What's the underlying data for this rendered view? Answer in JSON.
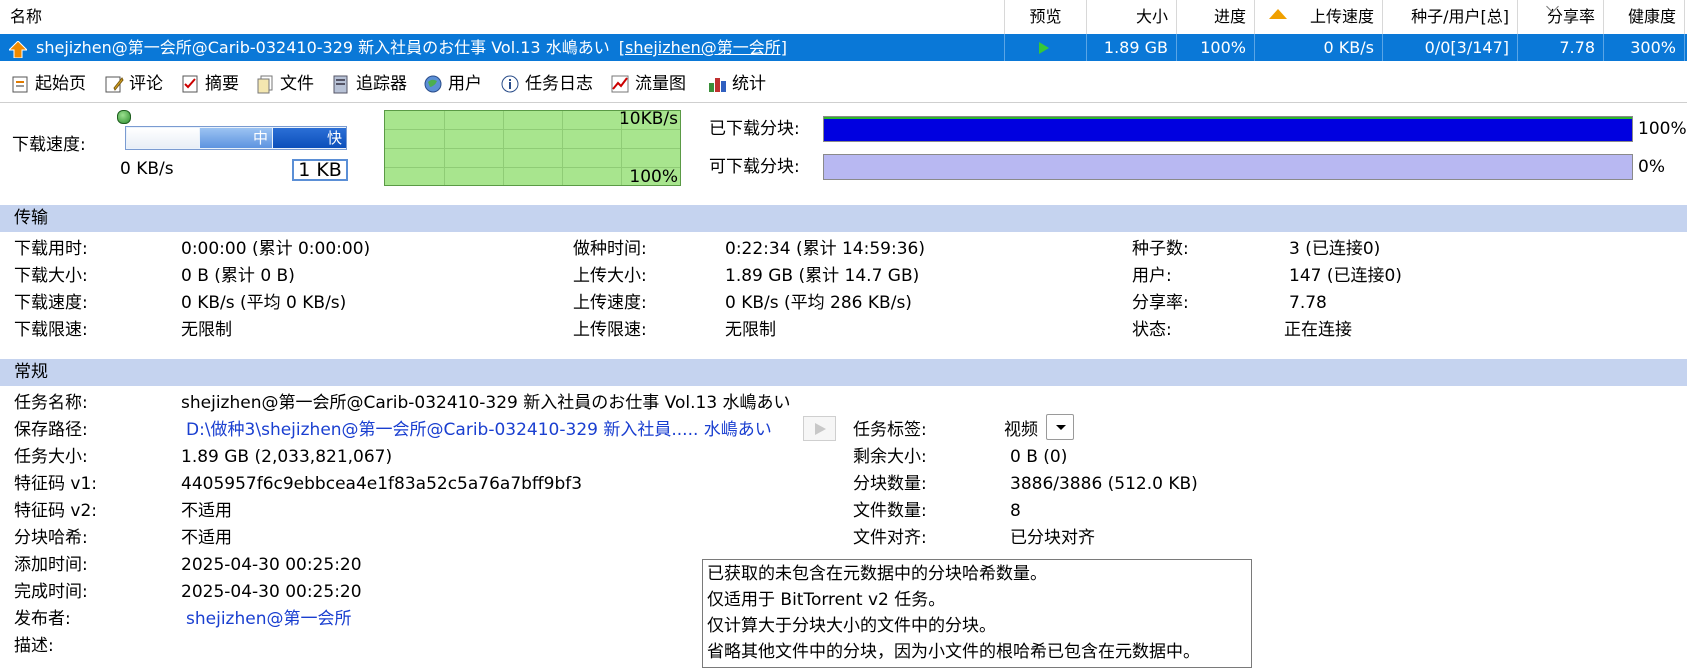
{
  "list": {
    "columns": {
      "name": "名称",
      "preview": "预览",
      "size": "大小",
      "progress": "进度",
      "upspeed": "上传速度",
      "seeds_peers": "种子/用户[总]",
      "ratio": "分享率",
      "health": "健康度"
    },
    "task": {
      "name": "shejizhen@第一会所@Carib-032410-329 新入社員のお仕事 Vol.13 水嶋あい",
      "tag": "[shejizhen@第一会所]",
      "size": "1.89 GB",
      "progress": "100%",
      "upspeed": "0 KB/s",
      "seeds_peers": "0/0[3/147]",
      "ratio": "7.78",
      "health": "300%"
    }
  },
  "tabs": [
    {
      "label": "起始页",
      "icon": "home-icon"
    },
    {
      "label": "评论",
      "icon": "comment-icon"
    },
    {
      "label": "摘要",
      "icon": "summary-icon"
    },
    {
      "label": "文件",
      "icon": "files-icon"
    },
    {
      "label": "追踪器",
      "icon": "tracker-icon"
    },
    {
      "label": "用户",
      "icon": "users-icon"
    },
    {
      "label": "任务日志",
      "icon": "info-icon"
    },
    {
      "label": "流量图",
      "icon": "chart-icon"
    },
    {
      "label": "统计",
      "icon": "stats-icon"
    }
  ],
  "summary": {
    "download_speed_label": "下载速度:",
    "current_speed": "0 KB/s",
    "slider_mid": "中",
    "slider_fast": "快",
    "limit_value": "1 KB",
    "graph_max": "10KB/s",
    "graph_pct": "100%",
    "downloaded_label": "已下载分块:",
    "downloaded_pct": "100%",
    "downloaded_fraction": 1.0,
    "available_label": "可下载分块:",
    "available_pct": "0%",
    "available_fraction": 1.0
  },
  "colors": {
    "selected_row": "#0a78d7",
    "section_bg": "#c5d3ef",
    "downloaded_bar": "#0000e0",
    "available_bar": "#b8b8f2",
    "graph_bg": "#a8e58e",
    "link": "#1a3fd0"
  },
  "transfer": {
    "title": "传输",
    "dl_time_label": "下载用时:",
    "dl_time": "0:00:00 (累计 0:00:00)",
    "dl_size_label": "下载大小:",
    "dl_size": "0 B (累计 0 B)",
    "dl_speed_label": "下载速度:",
    "dl_speed": "0 KB/s (平均 0 KB/s)",
    "dl_limit_label": "下载限速:",
    "dl_limit": "无限制",
    "seed_time_label": "做种时间:",
    "seed_time": "0:22:34 (累计 14:59:36)",
    "up_size_label": "上传大小:",
    "up_size": "1.89 GB (累计 14.7 GB)",
    "up_speed_label": "上传速度:",
    "up_speed": "0 KB/s (平均 286 KB/s)",
    "up_limit_label": "上传限速:",
    "up_limit": "无限制",
    "seeds_label": "种子数:",
    "seeds": "3 (已连接0)",
    "peers_label": "用户:",
    "peers": "147 (已连接0)",
    "ratio_label": "分享率:",
    "ratio": "7.78",
    "status_label": "状态:",
    "status": "正在连接"
  },
  "general": {
    "title": "常规",
    "name_label": "任务名称:",
    "name": "shejizhen@第一会所@Carib-032410-329 新入社員のお仕事 Vol.13 水嶋あい",
    "path_label": "保存路径:",
    "path": "D:\\做种3\\shejizhen@第一会所@Carib-032410-329 新入社員..... 水嶋あい",
    "size_label": "任务大小:",
    "size": "1.89 GB (2,033,821,067)",
    "hash1_label": "特征码 v1:",
    "hash1": "4405957f6c9ebbcea4e1f83a52c5a76a7bff9bf3",
    "hash2_label": "特征码 v2:",
    "hash2": "不适用",
    "piece_hash_label": "分块哈希:",
    "piece_hash": "不适用",
    "added_label": "添加时间:",
    "added": "2025-04-30 00:25:20",
    "completed_label": "完成时间:",
    "completed": "2025-04-30 00:25:20",
    "publisher_label": "发布者:",
    "publisher": "shejizhen@第一会所",
    "desc_label": "描述:",
    "tag_label": "任务标签:",
    "tag": "视频",
    "remaining_label": "剩余大小:",
    "remaining": "0 B (0)",
    "pieces_label": "分块数量:",
    "pieces": "3886/3886 (512.0 KB)",
    "files_label": "文件数量:",
    "files": "8",
    "align_label": "文件对齐:",
    "align": "已分块对齐"
  },
  "tooltip": {
    "line1": "已获取的未包含在元数据中的分块哈希数量。",
    "line2": "仅适用于 BitTorrent v2 任务。",
    "line3": "仅计算大于分块大小的文件中的分块。",
    "line4": "省略其他文件中的分块，因为小文件的根哈希已包含在元数据中。"
  }
}
